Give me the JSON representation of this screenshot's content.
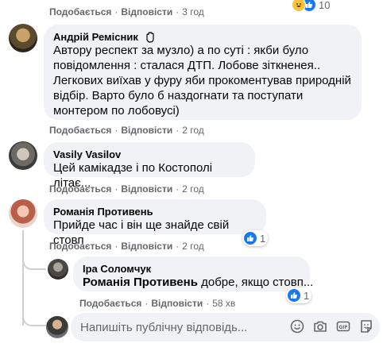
{
  "top_meta": {
    "like": "Подобається",
    "reply": "Відповісти",
    "time": "3 год",
    "reactions": "10"
  },
  "comments": [
    {
      "author": "Андрій Ремісник",
      "lines": [
        "Автору респект за музло) а по суті : якби було",
        "повідомлення : сталася ДТП. Лобове зіткненея..",
        "Легкових виїхав у фуру яби прокоментував природній",
        "відбір. Варто було б наздогнати та поступати",
        "монтером по лобовусі)"
      ],
      "like": "Подобається",
      "reply": "Відповісти",
      "time": "2 год"
    },
    {
      "author": "Vasily Vasilov",
      "text": "Цей камікадзе і по Костополі літає...",
      "like": "Подобається",
      "reply": "Відповісти",
      "time": "2 год"
    },
    {
      "author": "Романія Противень",
      "text": "Прийде час і він ще знайде свій стовп",
      "reactions": "1",
      "like": "Подобається",
      "reply": "Відповісти",
      "time": "2 год"
    }
  ],
  "reply": {
    "author": "Іра Соломчук",
    "mention": "Романія Противень",
    "text": " добре, якщо стовп...",
    "reactions": "1",
    "like": "Подобається",
    "reply": "Відповісти",
    "time": "58 хв"
  },
  "composer": {
    "placeholder": "Напишіть публічну відповідь..."
  },
  "colors": {
    "like_blue": "#1877f2",
    "bubble": "#f0f2f5",
    "meta": "#65676b"
  }
}
